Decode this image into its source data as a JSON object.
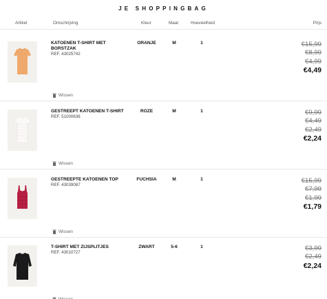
{
  "page": {
    "title": "JE SHOPPINGBAG"
  },
  "columns": {
    "article": "Artikel",
    "description": "Omschrijving",
    "color": "Kleur",
    "size": "Maat",
    "quantity": "Hoeveelheid",
    "price": "Prijs"
  },
  "remove_label": "Wissen",
  "items": [
    {
      "name": "KATOENEN T-SHIRT MET BORSTZAK",
      "ref": "REF. 43025742",
      "color": "ORANJE",
      "size": "M",
      "quantity": "1",
      "old_prices": [
        "€15,99",
        "€8,99",
        "€4,99"
      ],
      "price": "€4,49",
      "image": "orange-tshirt",
      "image_color": "#f0a96d"
    },
    {
      "name": "GESTREEPT KATOENEN T-SHIRT",
      "ref": "REF. 51000636",
      "color": "ROZE",
      "size": "M",
      "quantity": "1",
      "old_prices": [
        "€9,99",
        "€4,49",
        "€2,49"
      ],
      "price": "€2,24",
      "image": "white-striped-tshirt",
      "image_color": "#f7f3f1"
    },
    {
      "name": "GESTREEPTE KATOENEN TOP",
      "ref": "REF. 43039087",
      "color": "FUCHSIA",
      "size": "M",
      "quantity": "1",
      "old_prices": [
        "€15,99",
        "€7,99",
        "€1,99"
      ],
      "price": "€1,79",
      "image": "fuchsia-top",
      "image_color": "#b62042"
    },
    {
      "name": "T-SHIRT MET ZIJSPLITJES",
      "ref": "REF. 43010727",
      "color": "ZWART",
      "size": "5-6",
      "quantity": "1",
      "old_prices": [
        "€3,99",
        "€2,49"
      ],
      "price": "€2,24",
      "image": "black-tshirt",
      "image_color": "#1a1a1a"
    }
  ]
}
